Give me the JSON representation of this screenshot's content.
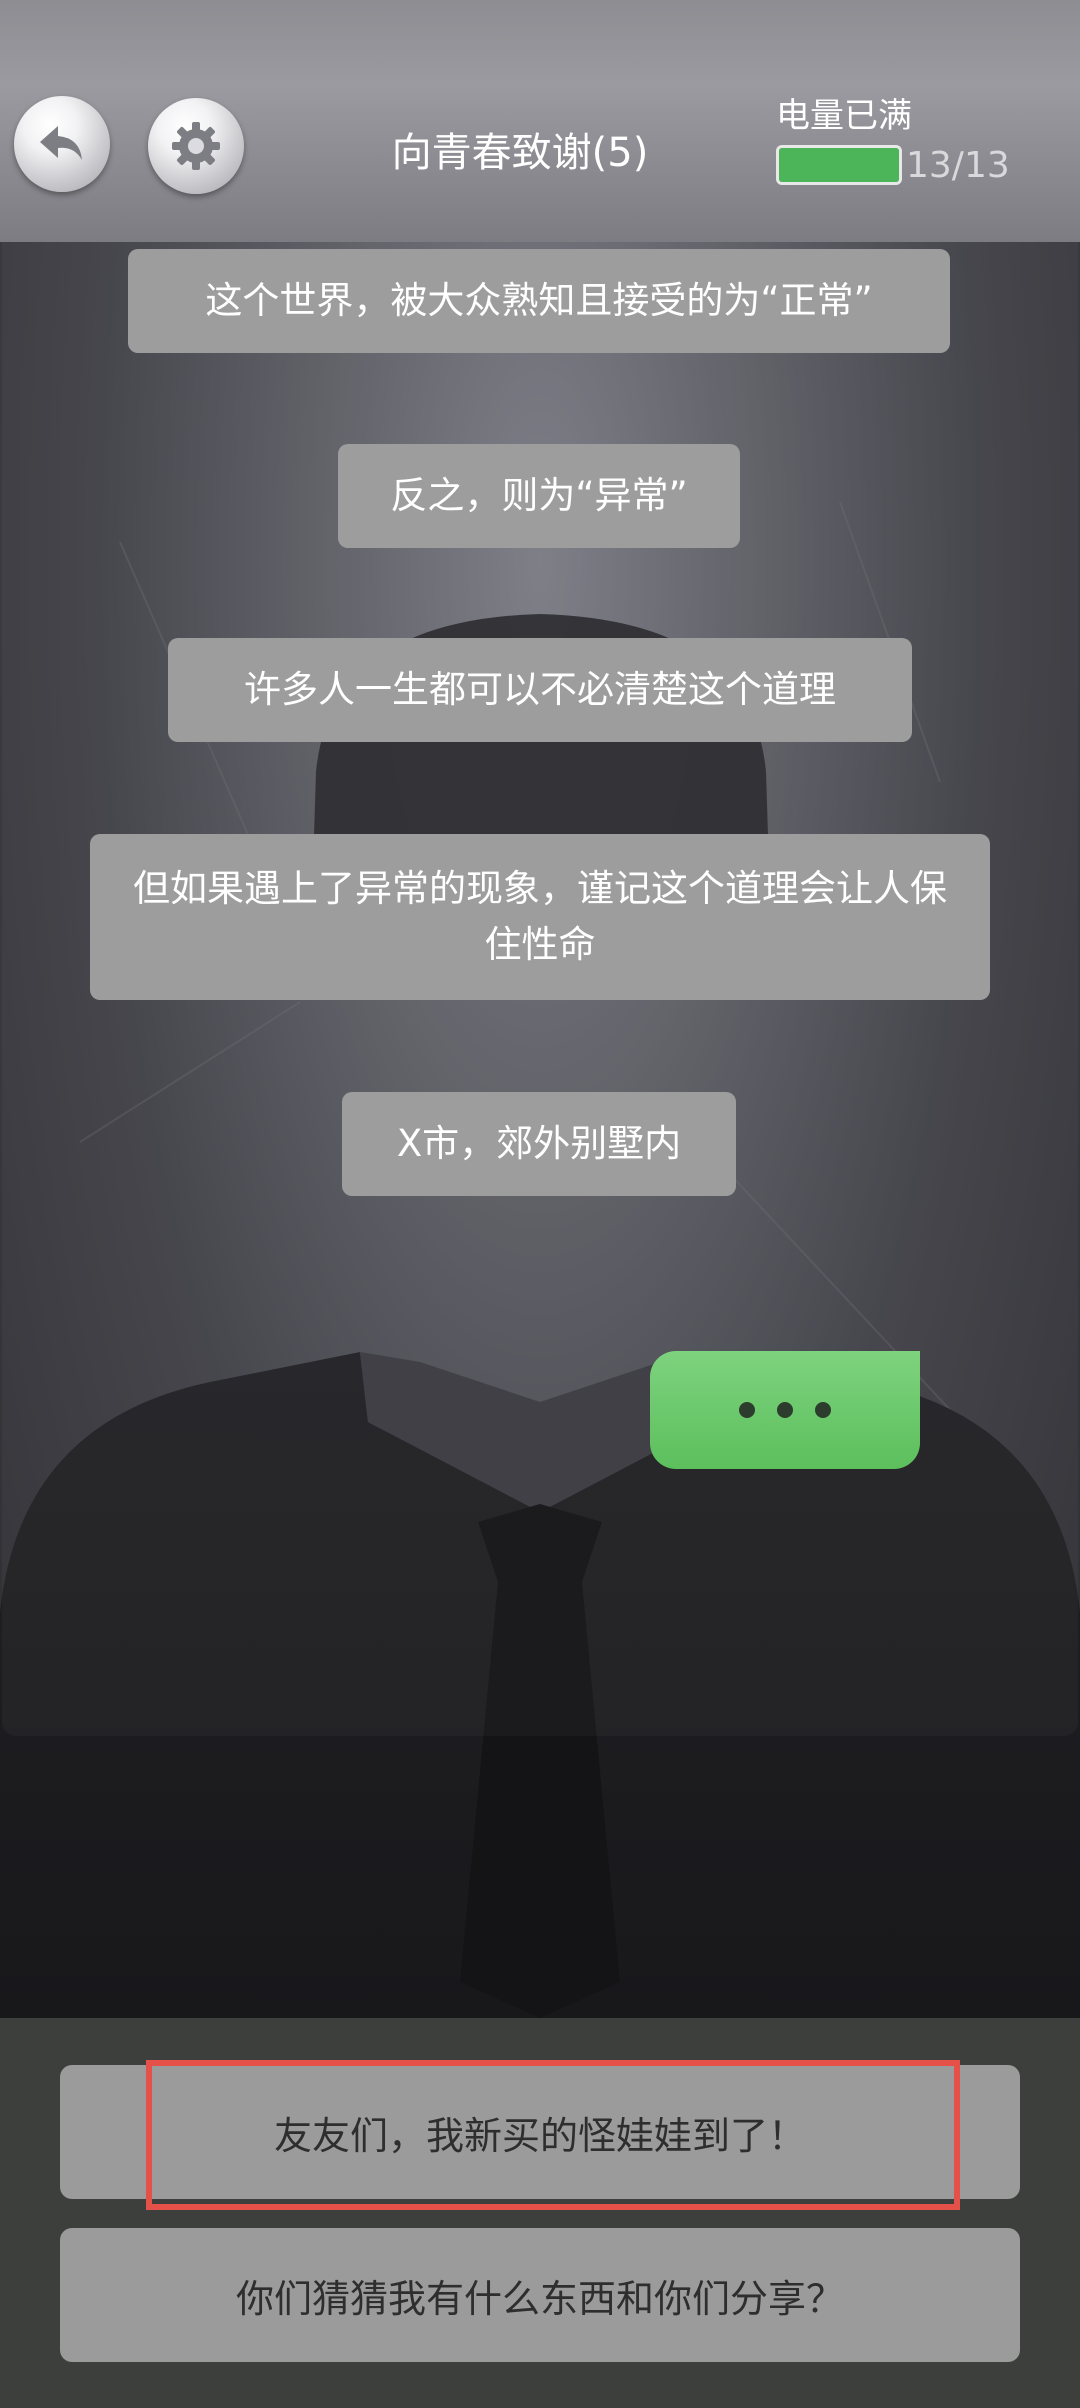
{
  "header": {
    "title": "向青春致谢(5)",
    "battery_label": "电量已满",
    "battery_count": "13/13",
    "battery_level": 1.0,
    "back_icon": "back-arrow-icon",
    "settings_icon": "gear-icon"
  },
  "chat": {
    "messages": [
      "这个世界，被大众熟知且接受的为“正常”",
      "反之，则为“异常”",
      "许多人一生都可以不必清楚这个道理",
      "但如果遇上了异常的现象，谨记这个道理会让人保住性命",
      "X市，郊外别墅内"
    ],
    "typing_indicator": "typing-dots"
  },
  "choices": [
    "友友们，我新买的怪娃娃到了！",
    "你们猜猜我有什么东西和你们分享？"
  ],
  "colors": {
    "bubble": "#9d9d9d",
    "typing_bubble": "#5cbf5c",
    "battery_fill": "#4cb55a",
    "highlight": "#e55048"
  }
}
